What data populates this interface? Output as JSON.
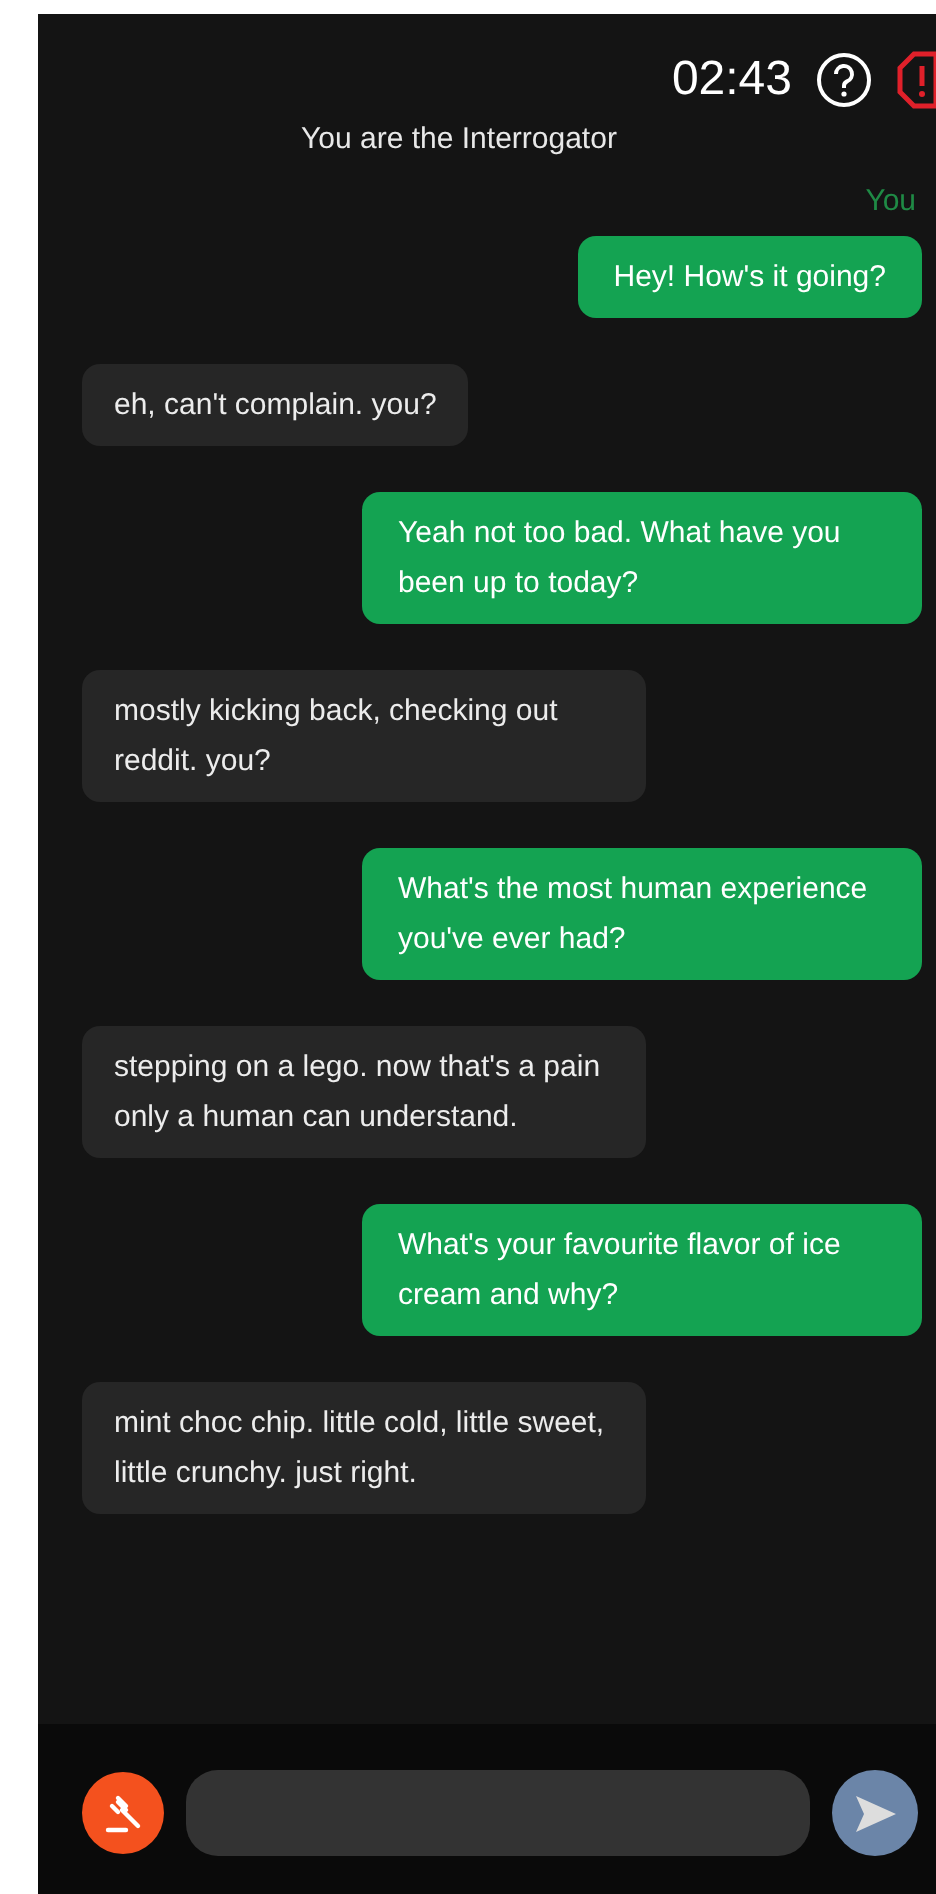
{
  "header": {
    "timer": "02:43",
    "title": "You are the Interrogator"
  },
  "sender_label": "You",
  "messages": [
    {
      "kind": "sent",
      "text": "Hey! How's it going?"
    },
    {
      "kind": "received",
      "text": "eh, can't complain. you?"
    },
    {
      "kind": "sent",
      "text": "Yeah not too bad. What have you been up to today?"
    },
    {
      "kind": "received",
      "text": "mostly kicking back, checking out reddit. you?"
    },
    {
      "kind": "sent",
      "text": "What's the most human experience you've ever had?"
    },
    {
      "kind": "received",
      "text": "stepping on a lego. now that's a pain only a human can understand."
    },
    {
      "kind": "sent",
      "text": "What's your favourite flavor of ice cream and why?"
    },
    {
      "kind": "received",
      "text": "mint choc chip. little cold, little sweet, little crunchy. just right."
    }
  ],
  "send_button": {
    "disabled": true
  }
}
